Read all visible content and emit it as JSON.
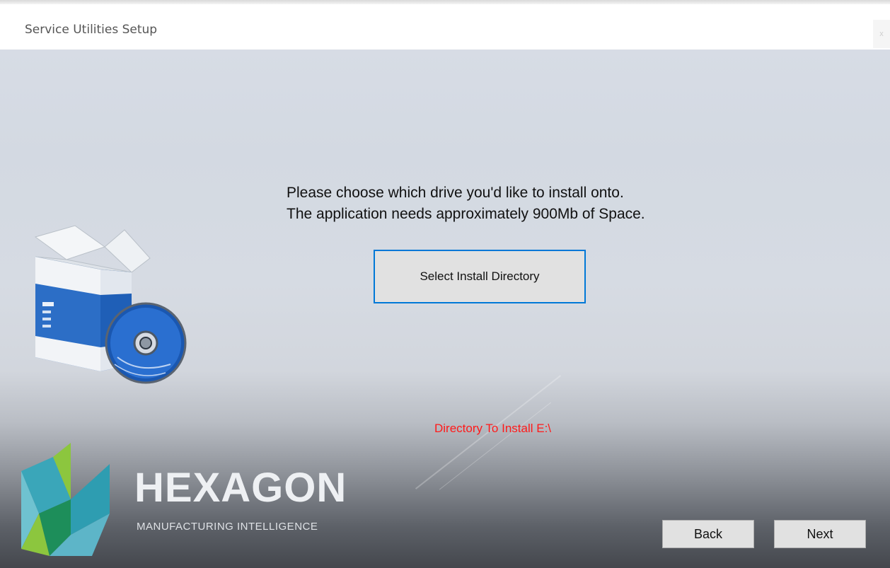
{
  "window": {
    "title": "Service Utilities Setup",
    "close_label": "x"
  },
  "main": {
    "message_line1": "Please choose which drive you'd like to install onto.",
    "message_line2": "The application needs approximately 900Mb of Space.",
    "select_button_label": "Select Install Directory",
    "directory_status": "Directory To Install  E:\\"
  },
  "branding": {
    "name": "HEXAGON",
    "tagline": "MANUFACTURING INTELLIGENCE"
  },
  "footer": {
    "back_label": "Back",
    "next_label": "Next"
  },
  "icons": {
    "installer": "software-box-with-cd-icon",
    "logo": "hexagon-logo-icon"
  },
  "colors": {
    "status_text": "#ff1a1a",
    "focus_border": "#0078d7",
    "button_face": "#e1e1e1"
  }
}
